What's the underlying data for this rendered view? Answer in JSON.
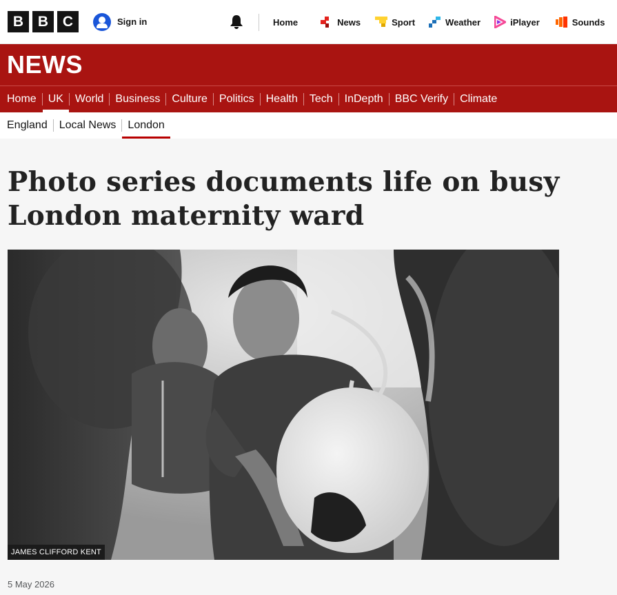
{
  "brand": {
    "letters": [
      "B",
      "B",
      "C"
    ]
  },
  "account": {
    "signin_label": "Sign in"
  },
  "global_nav": [
    {
      "label": "Home",
      "icon": "none"
    },
    {
      "label": "News",
      "icon": "news-icon",
      "color": "#e4221d"
    },
    {
      "label": "Sport",
      "icon": "sport-icon",
      "color": "#ffd230"
    },
    {
      "label": "Weather",
      "icon": "weather-icon",
      "color": "#1d70b8"
    },
    {
      "label": "iPlayer",
      "icon": "iplayer-icon",
      "color": "#f54997"
    },
    {
      "label": "Sounds",
      "icon": "sounds-icon",
      "color": "#ff6600"
    }
  ],
  "banner": {
    "title": "NEWS"
  },
  "section_nav": [
    "Home",
    "UK",
    "World",
    "Business",
    "Culture",
    "Politics",
    "Health",
    "Tech",
    "InDepth",
    "BBC Verify",
    "Climate"
  ],
  "section_nav_active": "UK",
  "sub_nav": [
    "England",
    "Local News",
    "London"
  ],
  "sub_nav_active": "London",
  "article": {
    "headline": "Photo series documents life on busy London maternity ward",
    "image_credit": "JAMES CLIFFORD KENT",
    "date": "5 May 2026"
  },
  "colors": {
    "brand_red": "#a91411",
    "accent_red": "#b80000"
  }
}
